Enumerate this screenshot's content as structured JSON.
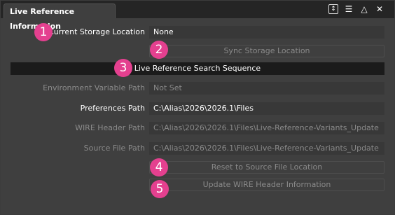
{
  "window": {
    "tab_title": "Live Reference Information",
    "icons": [
      "pin-icon",
      "menu-icon",
      "triangle-icon",
      "close-icon"
    ]
  },
  "current_storage": {
    "label": "Current Storage Location",
    "value": "None"
  },
  "sync_button": "Sync Storage Location",
  "section_header": "Live Reference Search Sequence",
  "env_var": {
    "label": "Environment Variable Path",
    "value": "Not Set"
  },
  "preferences": {
    "label": "Preferences Path",
    "value": "C:\\Alias\\2026\\2026.1\\Files"
  },
  "wire_header": {
    "label": "WIRE Header Path",
    "value": "C:\\Alias\\2026\\2026.1\\Files\\Live-Reference-Variants_Update"
  },
  "source_file": {
    "label": "Source File Path",
    "value": "C:\\Alias\\2026\\2026.1\\Files\\Live-Reference-Variants_Update"
  },
  "reset_button": "Reset to Source File Location",
  "update_button": "Update WIRE Header Information",
  "badges": [
    "1",
    "2",
    "3",
    "4",
    "5"
  ],
  "colors": {
    "badge": "#e4408f",
    "window_bg": "#3f3f3f",
    "field_bg": "#383838"
  }
}
